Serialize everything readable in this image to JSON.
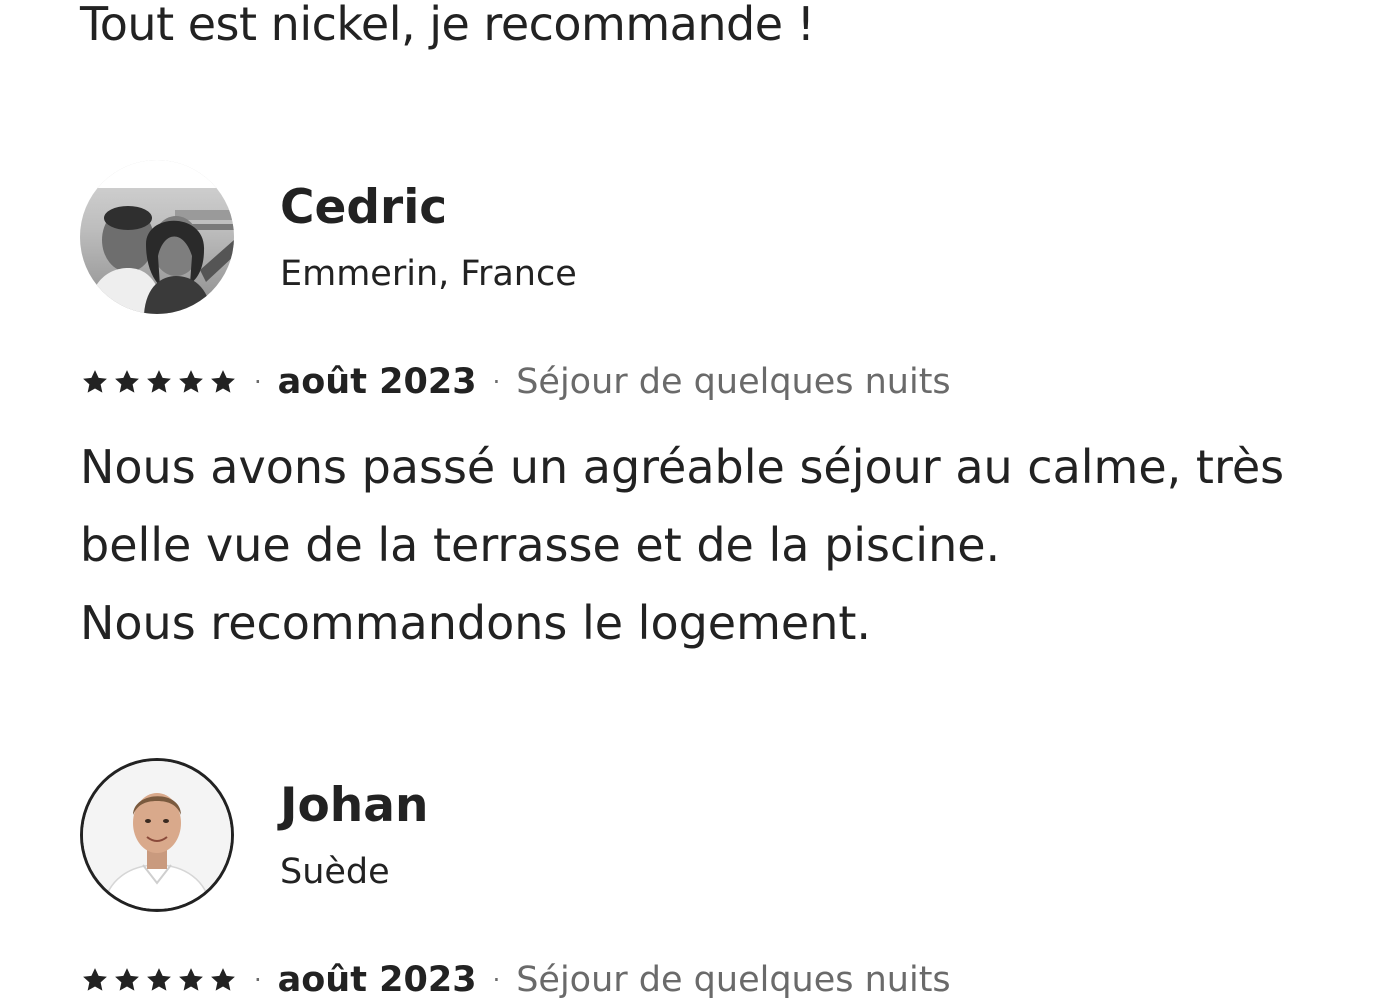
{
  "previous_review": {
    "text": "Tout est nickel, je recommande !"
  },
  "reviews": [
    {
      "name": "Cedric",
      "location": "Emmerin, France",
      "rating": 5,
      "date": "août 2023",
      "stay": "Séjour de quelques nuits",
      "text_lines": [
        "Nous avons passé un agréable séjour au calme, très",
        "belle vue de la terrasse et de la piscine.",
        "Nous recommandons le logement."
      ],
      "avatar_icon": "couple-photo-icon"
    },
    {
      "name": "Johan",
      "location": "Suède",
      "rating": 5,
      "date": "août 2023",
      "stay": "Séjour de quelques nuits",
      "avatar_icon": "portrait-photo-icon"
    }
  ],
  "separator": "·",
  "colors": {
    "text": "#222222",
    "muted": "#6a6a6a",
    "background": "#ffffff"
  }
}
